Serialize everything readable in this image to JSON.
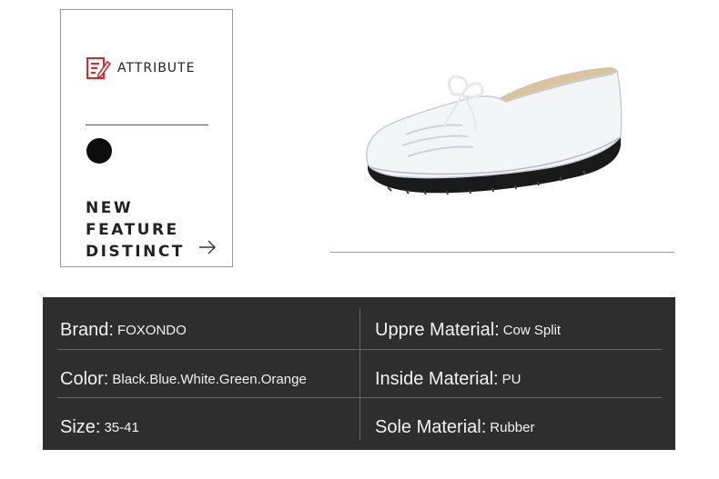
{
  "attribute_card": {
    "icon": "document-pen-icon",
    "title": "ATTRIBUTE",
    "swatch_color": "#0d0d0d",
    "feature_lines": [
      "NEW",
      "FEATURE",
      "DISTINCT"
    ],
    "arrow_icon": "arrow-right-icon"
  },
  "product_image": {
    "subject": "white leather lace-up loafer",
    "colors": {
      "upper": "#f4f5f7",
      "sole": "#1a1a1a",
      "lining": "#d9c49b"
    }
  },
  "specs": {
    "panel_color": "#2e2e2e",
    "rows": [
      {
        "left_key": "Brand:",
        "left_value": "FOXONDO",
        "right_key": "Uppre Material:",
        "right_value": "Cow Split"
      },
      {
        "left_key": "Color:",
        "left_value": "Black.Blue.White.Green.Orange",
        "right_key": "Inside Material:",
        "right_value": "PU"
      },
      {
        "left_key": "Size:",
        "left_value": "35-41",
        "right_key": "Sole Material:",
        "right_value": "Rubber"
      }
    ]
  }
}
